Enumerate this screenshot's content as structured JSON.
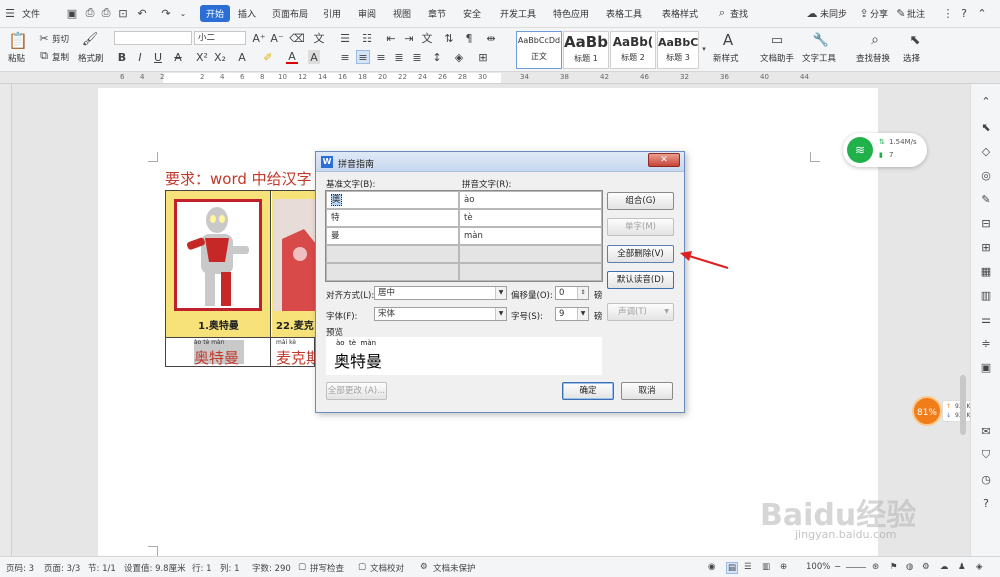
{
  "menubar": {
    "file": "文件",
    "tabs": [
      "开始",
      "插入",
      "页面布局",
      "引用",
      "审阅",
      "视图",
      "章节",
      "安全",
      "开发工具",
      "特色应用",
      "表格工具",
      "表格样式"
    ],
    "search": "查找",
    "sync": "未同步",
    "share": "分享",
    "comment": "批注"
  },
  "ribbon": {
    "paste": "粘贴",
    "cut": "剪切",
    "copy": "复制",
    "format_painter": "格式刷",
    "font_name": "",
    "font_size": "小二",
    "bold": "B",
    "italic": "I",
    "underline": "U",
    "styles": [
      {
        "sample": "AaBbCcDd",
        "name": "正文"
      },
      {
        "sample": "AaBb",
        "name": "标题 1"
      },
      {
        "sample": "AaBb(",
        "name": "标题 2"
      },
      {
        "sample": "AaBbC(",
        "name": "标题 3"
      }
    ],
    "new_style": "新样式",
    "doc_helper": "文档助手",
    "text_tools": "文字工具",
    "find_replace": "查找替换",
    "select": "选择"
  },
  "ruler_ticks": [
    "6",
    "4",
    "2",
    "",
    "2",
    "4",
    "6",
    "8",
    "10",
    "12",
    "14",
    "16",
    "18",
    "20",
    "22",
    "24",
    "26",
    "28",
    "30",
    "32",
    "34",
    "36",
    "38",
    "40",
    "42",
    "44",
    "46"
  ],
  "document": {
    "heading": "要求：word 中给汉字",
    "card1_label": "1.奥特曼",
    "card2_label": "22.麦克",
    "row2_pinyin1": "ào tè màn",
    "row2_text1": "奥特曼",
    "row2_pinyin2": "mài kè",
    "row2_text2": "麦克斯"
  },
  "dialog": {
    "title": "拼音指南",
    "base_col": "基准文字(B):",
    "pinyin_col": "拼音文字(R):",
    "rows": [
      {
        "base": "奥",
        "pinyin": "ào"
      },
      {
        "base": "特",
        "pinyin": "tè"
      },
      {
        "base": "曼",
        "pinyin": "màn"
      }
    ],
    "btn_group": "组合(G)",
    "btn_single": "单字(M)",
    "btn_clear_all": "全部删除(V)",
    "btn_default": "默认读音(D)",
    "align_label": "对齐方式(L):",
    "align_value": "居中",
    "offset_label": "偏移量(O):",
    "offset_value": "0",
    "offset_unit": "磅",
    "font_label": "字体(F):",
    "font_value": "宋体",
    "size_label": "字号(S):",
    "size_value": "9",
    "size_unit": "磅",
    "tone_btn": "声调(T)",
    "preview_label": "预览",
    "preview_pinyin": "ào  tè  màn",
    "preview_text": "奥特曼",
    "btn_change_all": "全部更改 (A)...",
    "btn_ok": "确定",
    "btn_cancel": "取消"
  },
  "network_widget": {
    "upload": "1.54M/s",
    "count": "7"
  },
  "speed_widget": {
    "percent": "81%",
    "up": "933K/s",
    "down": "933K/s"
  },
  "statusbar": {
    "pages_count": "页码: 3",
    "page": "页面: 3/3",
    "section": "节: 1/1",
    "setting": "设置值: 9.8厘米",
    "row": "行: 1",
    "col": "列: 1",
    "words": "字数: 290",
    "spell": "拼写检查",
    "proof": "文档校对",
    "protect": "文档未保护",
    "zoom": "100%"
  },
  "watermark": {
    "brand": "Baidu经验",
    "url": "jingyan.baidu.com"
  },
  "colors": {
    "accent": "#2b6fd6",
    "heading_red": "#c0392b",
    "arrow_red": "#e02020",
    "wifi_green": "#21b14b",
    "orange": "#f07d1a"
  }
}
